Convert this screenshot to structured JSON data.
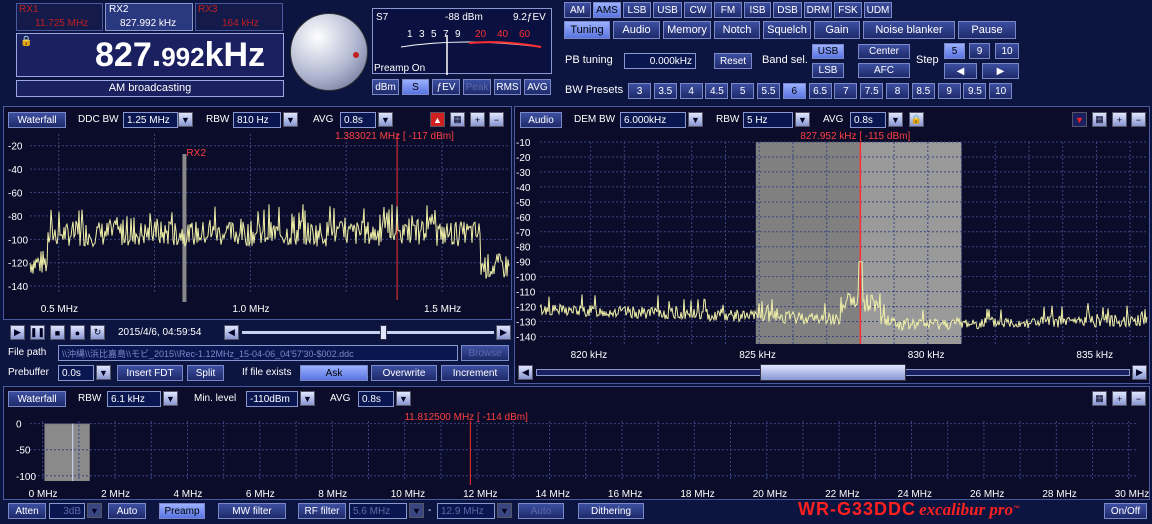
{
  "rx": {
    "rx1_label": "RX1",
    "rx1_freq": "11.725 MHz",
    "rx2_label": "RX2",
    "rx2_freq": "827.992 kHz",
    "rx3_label": "RX3",
    "rx3_freq": "164 kHz"
  },
  "display": {
    "freq_main": "827.",
    "freq_small": "992",
    "freq_unit": "kHz",
    "mode_desc": "AM broadcasting"
  },
  "smeter": {
    "s_label": "S7",
    "dbm": "-88 dBm",
    "fev": "9.2ƒEV",
    "scale": [
      "1",
      "3",
      "5",
      "7",
      "9",
      "20",
      "40",
      "60"
    ],
    "preamp": "Preamp On",
    "btn_dbm": "dBm",
    "btn_s": "S",
    "btn_fev": "ƒEV",
    "btn_peak": "Peak",
    "btn_rms": "RMS",
    "btn_avg": "AVG"
  },
  "modes": [
    "AM",
    "AMS",
    "LSB",
    "USB",
    "CW",
    "FM",
    "ISB",
    "DSB",
    "DRM",
    "FSK",
    "UDM"
  ],
  "tabs": [
    "Tuning",
    "Audio",
    "Memory",
    "Notch",
    "Squelch",
    "Gain",
    "Noise blanker",
    "Pause"
  ],
  "tuning": {
    "pb_label": "PB tuning",
    "pb_value": "0.000kHz",
    "reset": "Reset",
    "band_label": "Band sel.",
    "usb": "USB",
    "lsb": "LSB",
    "center": "Center",
    "afc": "AFC",
    "step_label": "Step",
    "steps": [
      "5",
      "9",
      "10"
    ],
    "left": "◀",
    "right": "▶",
    "bw_label": "BW Presets",
    "bw": [
      "3",
      "3.5",
      "4",
      "4.5",
      "5",
      "5.5",
      "6",
      "6.5",
      "7",
      "7.5",
      "8",
      "8.5",
      "9",
      "9.5",
      "10"
    ]
  },
  "ddc": {
    "waterfall": "Waterfall",
    "ddc_bw_label": "DDC BW",
    "ddc_bw": "1.25 MHz",
    "rbw_label": "RBW",
    "rbw": "810 Hz",
    "avg_label": "AVG",
    "avg": "0.8s",
    "marker": "1.383021 MHz [ -117 dBm]",
    "rx2_tag": "RX2",
    "yticks": [
      "-20",
      "-40",
      "-60",
      "-80",
      "-100",
      "-120",
      "-140"
    ],
    "xticks": [
      "0.5 MHz",
      "1.0 MHz",
      "1.5 MHz"
    ]
  },
  "player": {
    "datetime": "2015/4/6, 04:59:54",
    "file_label": "File path",
    "file_path": "\\\\沖縄\\\\浜比嘉島\\\\モビ_2015\\\\Rec-1.12MHz_15-04-06_04'57'30-$002.ddc",
    "browse": "Browse",
    "prebuffer_label": "Prebuffer",
    "prebuffer": "0.0s",
    "insert_fdt": "Insert FDT",
    "split": "Split",
    "exists_label": "If file exists",
    "ask": "Ask",
    "overwrite": "Overwrite",
    "increment": "Increment"
  },
  "audio": {
    "btn": "Audio",
    "dem_bw_label": "DEM BW",
    "dem_bw": "6.000kHz",
    "rbw_label": "RBW",
    "rbw": "5 Hz",
    "avg_label": "AVG",
    "avg": "0.8s",
    "marker": "827.952 kHz [ -115 dBm]",
    "yticks": [
      "-10",
      "-20",
      "-30",
      "-40",
      "-50",
      "-60",
      "-70",
      "-80",
      "-90",
      "-100",
      "-110",
      "-120",
      "-130",
      "-140"
    ],
    "xticks": [
      "820 kHz",
      "825 kHz",
      "830 kHz",
      "835 kHz"
    ]
  },
  "wide": {
    "waterfall": "Waterfall",
    "rbw_label": "RBW",
    "rbw": "6.1 kHz",
    "min_label": "Min. level",
    "min": "-110dBm",
    "avg_label": "AVG",
    "avg": "0.8s",
    "marker": "11.812500 MHz [ -114 dBm]",
    "yticks": [
      "0",
      "-50",
      "-100"
    ],
    "xticks": [
      "0 MHz",
      "2 MHz",
      "4 MHz",
      "6 MHz",
      "8 MHz",
      "10 MHz",
      "12 MHz",
      "14 MHz",
      "16 MHz",
      "18 MHz",
      "20 MHz",
      "22 MHz",
      "24 MHz",
      "26 MHz",
      "28 MHz",
      "30 MHz"
    ]
  },
  "bottom": {
    "atten": "Atten",
    "atten_val": "3dB",
    "auto1": "Auto",
    "preamp": "Preamp",
    "mw": "MW filter",
    "rf": "RF filter",
    "rf_lo": "5.6 MHz",
    "dash": "-",
    "rf_hi": "12.9 MHz",
    "auto2": "Auto",
    "dither": "Dithering",
    "brand": "WR-G33DDC",
    "brand2": "excalibur pro",
    "tm": "™",
    "onoff": "On/Off"
  },
  "colors": {
    "trace": "#f0f0a8",
    "marker": "#ff3030",
    "accent": "#5a74e0"
  }
}
